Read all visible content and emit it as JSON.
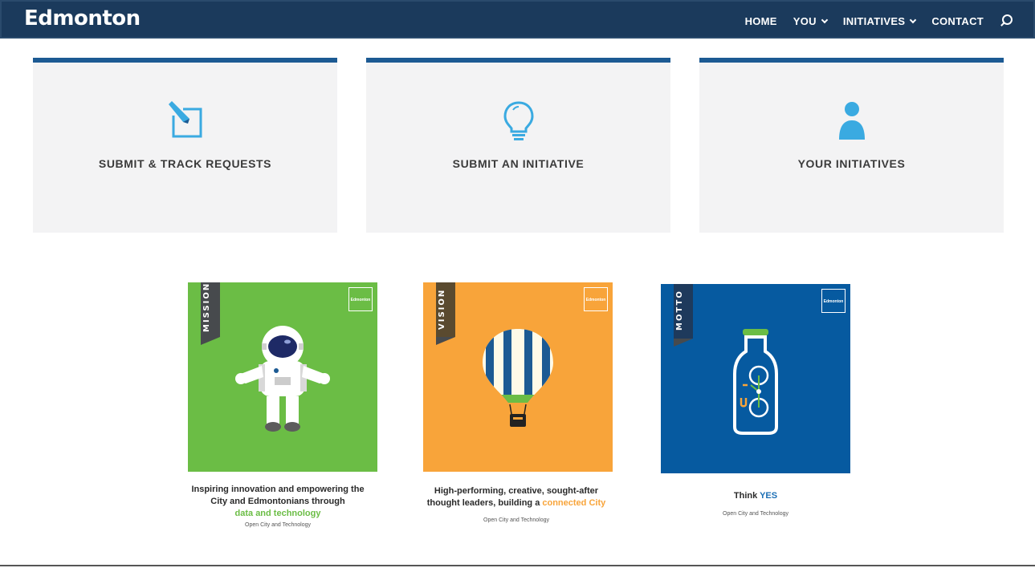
{
  "header": {
    "logo": "Edmonton",
    "nav": [
      {
        "label": "HOME"
      },
      {
        "label": "YOU"
      },
      {
        "label": "INITIATIVES"
      },
      {
        "label": "CONTACT"
      }
    ],
    "search_icon": "search-icon"
  },
  "cards": [
    {
      "label": "SUBMIT & TRACK REQUESTS",
      "icon": "edit-icon"
    },
    {
      "label": "SUBMIT AN INITIATIVE",
      "icon": "lightbulb-icon"
    },
    {
      "label": "YOUR INITIATIVES",
      "icon": "user-icon"
    }
  ],
  "posters": [
    {
      "ribbon": "MISSION",
      "mini_logo": "Edmonton",
      "caption_line1": "Inspiring innovation and empowering the",
      "caption_line2": "City and Edmontonians through",
      "caption_highlight": "data and technology",
      "sub": "Open City and Technology",
      "bg": "#6bbd45",
      "highlight_color": "#6bbd45"
    },
    {
      "ribbon": "VISION",
      "mini_logo": "Edmonton",
      "caption_line1": "High-performing, creative, sought-after",
      "caption_line2": "thought leaders, building a",
      "caption_highlight": "connected City",
      "sub": "Open City and Technology",
      "bg": "#f8a43a",
      "highlight_color": "#f8a43a"
    },
    {
      "ribbon": "MOTTO",
      "mini_logo": "Edmonton",
      "caption_line1": "Think",
      "caption_highlight": "YES",
      "sub": "Open City and Technology",
      "bg": "#065aa0",
      "highlight_color": "#1c6fb5"
    }
  ],
  "colors": {
    "nav_bg": "#1b3a5c",
    "card_bg": "#f3f3f4",
    "card_accent": "#1c5a93",
    "icon_blue": "#3aaae1"
  }
}
